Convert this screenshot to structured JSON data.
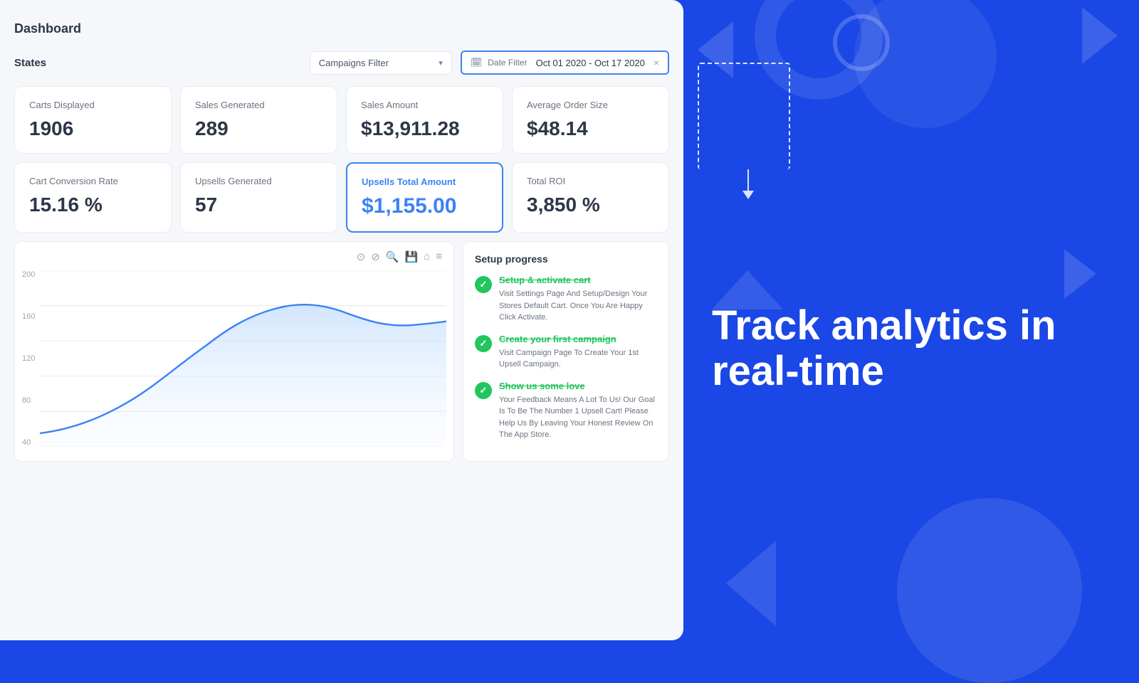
{
  "dashboard": {
    "title": "Dashboard",
    "states_label": "States",
    "campaigns_filter": {
      "label": "Campaigns Filter",
      "placeholder": "Campaigns Filter"
    },
    "date_filter": {
      "label": "Date Filter",
      "value": "Oct 01 2020 - Oct 17 2020"
    },
    "stats": [
      {
        "label": "Carts Displayed",
        "value": "1906"
      },
      {
        "label": "Sales Generated",
        "value": "289"
      },
      {
        "label": "Sales Amount",
        "value": "$13,911.28"
      },
      {
        "label": "Average Order Size",
        "value": "$48.14"
      },
      {
        "label": "Cart Conversion Rate",
        "value": "15.16 %"
      },
      {
        "label": "Upsells Generated",
        "value": "57"
      },
      {
        "label": "Upsells Total Amount",
        "value": "$1,155.00",
        "highlighted": true
      },
      {
        "label": "Total ROI",
        "value": "3,850 %"
      }
    ],
    "chart": {
      "y_labels": [
        "200",
        "160",
        "120",
        "80",
        "40"
      ]
    },
    "setup_progress": {
      "title": "Setup progress",
      "items": [
        {
          "title": "Setup & activate cart",
          "desc": "Visit Settings Page And Setup/Design Your Stores Default Cart. Once You Are Happy Click Activate."
        },
        {
          "title": "Create your first campaign",
          "desc": "Visit Campaign Page To Create Your 1st Upsell Campaign."
        },
        {
          "title": "Show us some love",
          "desc": "Your Feedback Means A Lot To Us! Our Goal Is To Be The Number 1 Upsell Cart! Please Help Us By Leaving Your Honest Review On The App Store."
        }
      ]
    }
  },
  "promo": {
    "text": "Track analytics in real-time"
  },
  "icons": {
    "chevron_down": "▾",
    "calendar": "📅",
    "close": "×",
    "toolbar_icons": [
      "⊙",
      "⊘",
      "⊕",
      "⊗",
      "⌂",
      "≡"
    ]
  }
}
